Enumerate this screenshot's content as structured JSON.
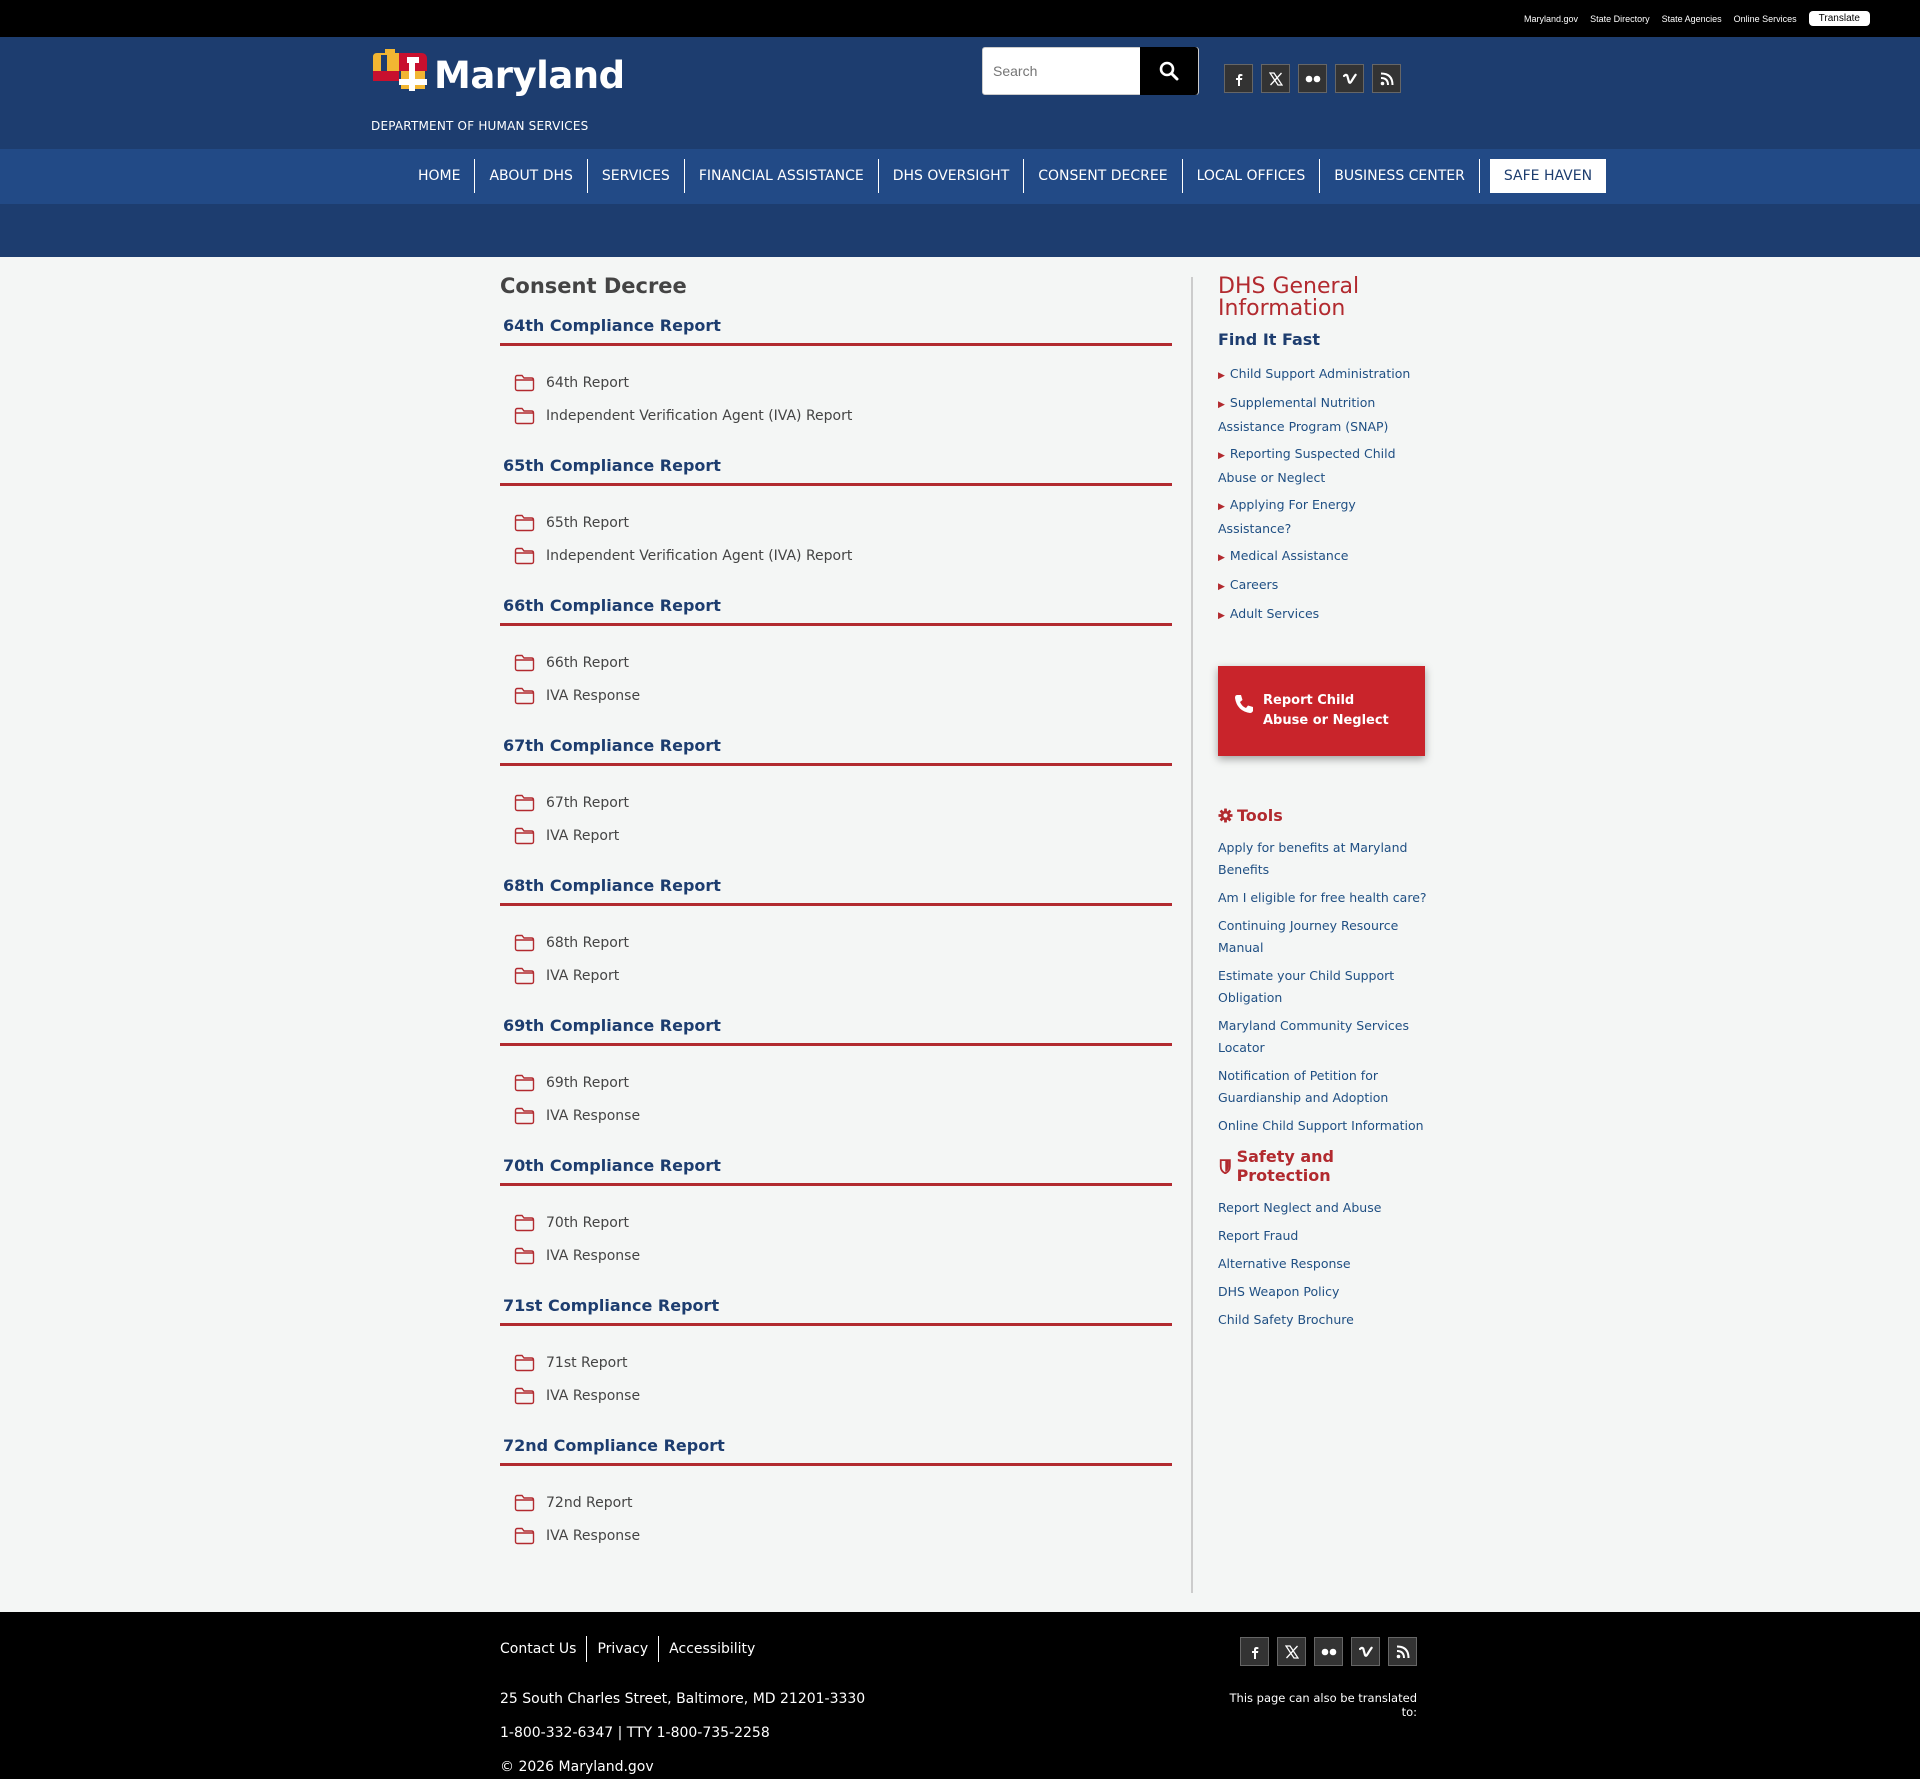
{
  "util_bar": {
    "links": [
      "Maryland.gov",
      "State Directory",
      "State Agencies",
      "Online Services"
    ],
    "translate_label": "Translate"
  },
  "header": {
    "logo_word": "Maryland",
    "logo_subtitle": "DEPARTMENT OF HUMAN SERVICES",
    "search_placeholder": "Search",
    "social_icons": [
      "facebook-icon",
      "x-icon",
      "flickr-icon",
      "vimeo-icon",
      "rss-icon"
    ]
  },
  "nav": {
    "items": [
      "HOME",
      "ABOUT DHS",
      "SERVICES",
      "FINANCIAL ASSISTANCE",
      "DHS OVERSIGHT",
      "CONSENT DECREE",
      "LOCAL OFFICES",
      "BUSINESS CENTER"
    ],
    "highlight": "SAFE HAVEN"
  },
  "main": {
    "page_title": "Consent Decree",
    "sections": [
      {
        "title": "64th Compliance Report",
        "docs": [
          "64th Report",
          "Independent Verification Agent (IVA) Report"
        ]
      },
      {
        "title": "65th Compliance Report",
        "docs": [
          "65th Report",
          "Independent Verification Agent (IVA) Report"
        ]
      },
      {
        "title": "66th Compliance Report",
        "docs": [
          "66th Report",
          "IVA Response"
        ]
      },
      {
        "title": "67th Compliance Report",
        "docs": [
          "67th Report",
          "IVA Report"
        ]
      },
      {
        "title": "68th Compliance Report",
        "docs": [
          "68th Report",
          "IVA Report"
        ]
      },
      {
        "title": "69th Compliance Report",
        "docs": [
          "69th Report",
          "IVA Response"
        ]
      },
      {
        "title": "70th Compliance Report",
        "docs": [
          "70th Report",
          "IVA Response"
        ]
      },
      {
        "title": "71st Compliance Report",
        "docs": [
          "71st Report",
          "IVA Response"
        ]
      },
      {
        "title": "72nd Compliance Report",
        "docs": [
          "72nd Report",
          "IVA Response"
        ]
      }
    ]
  },
  "sidebar": {
    "title_line1": "DHS General",
    "title_line2": "Information",
    "find_fast": "Find It Fast",
    "fast_links": [
      "Child Support Administration",
      "Supplemental Nutrition Assistance Program (SNAP)",
      "Reporting Suspected Child Abuse or Neglect",
      "Applying For Energy Assistance?",
      "Medical Assistance",
      "Careers",
      "Adult Services"
    ],
    "report_line1": "Report Child",
    "report_line2": "Abuse or Neglect",
    "tools_title": "Tools",
    "tools": [
      "Apply for benefits at Maryland Benefits",
      "Am I eligible for free health care?",
      "Continuing Journey Resource Manual",
      "Estimate your Child Support Obligation",
      "Maryland Community Services Locator",
      "Notification of Petition for Guardianship and Adoption",
      "Online Child Support Information"
    ],
    "safety_title": "Safety and Protection",
    "safety": [
      "Report Neglect and Abuse",
      "Report Fraud",
      "Alternative Response",
      "DHS Weapon Policy",
      "Child Safety Brochure"
    ]
  },
  "footer": {
    "links": [
      "Contact Us",
      "Privacy",
      "Accessibility"
    ],
    "address": "25 South Charles Street, Baltimore, MD 21201-3330",
    "phone": "1-800-332-6347 | TTY 1-800-735-2258",
    "copyright": "© 2026 Maryland.gov",
    "translate_note": "This page can also be translated to:"
  },
  "colors": {
    "header_blue": "#1d3d6f",
    "nav_blue": "#224a86",
    "accent_red": "#b22a2f",
    "link_blue": "#1f4f83"
  }
}
